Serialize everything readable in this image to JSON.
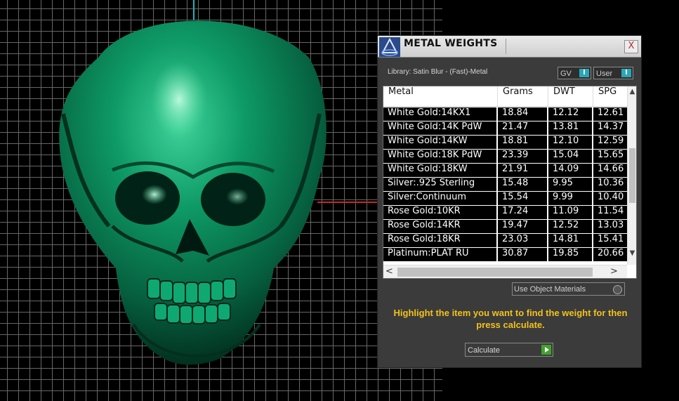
{
  "panel": {
    "title": "METAL WEIGHTS",
    "close": "X",
    "library_label": "Library: Satin Blur - (Fast)-Metal",
    "gv_toggle": "GV",
    "user_toggle": "User",
    "toggle_knob": "I",
    "use_object_materials": "Use Object Materials",
    "instructions": "Highlight the item you want to find the weight for then press calculate.",
    "calculate_label": "Calculate"
  },
  "table": {
    "columns": [
      "Metal",
      "Grams",
      "DWT",
      "SPG"
    ],
    "rows": [
      [
        "White Gold:14KX1",
        "18.84",
        "12.12",
        "12.61"
      ],
      [
        "White Gold:14K PdW",
        "21.47",
        "13.81",
        "14.37"
      ],
      [
        "White Gold:14KW",
        "18.81",
        "12.10",
        "12.59"
      ],
      [
        "White Gold:18K PdW",
        "23.39",
        "15.04",
        "15.65"
      ],
      [
        "White Gold:18KW",
        "21.91",
        "14.09",
        "14.66"
      ],
      [
        "Silver:.925 Sterling",
        "15.48",
        "9.95",
        "10.36"
      ],
      [
        "Silver:Continuum",
        "15.54",
        "9.99",
        "10.40"
      ],
      [
        "Rose Gold:10KR",
        "17.24",
        "11.09",
        "11.54"
      ],
      [
        "Rose Gold:14KR",
        "19.47",
        "12.52",
        "13.03"
      ],
      [
        "Rose Gold:18KR",
        "23.03",
        "14.81",
        "15.41"
      ],
      [
        "Platinum:PLAT RU",
        "30.87",
        "19.85",
        "20.66"
      ]
    ]
  },
  "scroll": {
    "up": "▲",
    "down": "▼",
    "left": "<",
    "right": ">"
  },
  "colors": {
    "skull": "#0d8a5e",
    "instructions": "#f2c21b",
    "toggle_knob": "#2aa7b8",
    "calculate_icon": "#3fa22c"
  }
}
